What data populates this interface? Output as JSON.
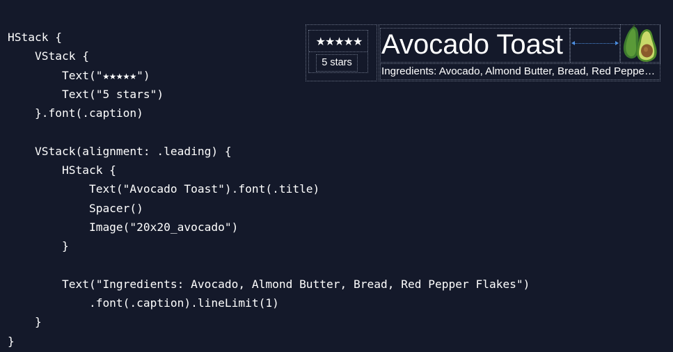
{
  "code": {
    "lines": [
      "HStack {",
      "    VStack {",
      "        Text(\"★★★★★\")",
      "        Text(\"5 stars\")",
      "    }.font(.caption)",
      "",
      "    VStack(alignment: .leading) {",
      "        HStack {",
      "            Text(\"Avocado Toast\").font(.title)",
      "            Spacer()",
      "            Image(\"20x20_avocado\")",
      "        }",
      "",
      "        Text(\"Ingredients: Avocado, Almond Butter, Bread, Red Pepper Flakes\")",
      "            .font(.caption).lineLimit(1)",
      "    }",
      "}"
    ]
  },
  "preview": {
    "stars": "★★★★★",
    "rating_label": "5 stars",
    "title": "Avocado Toast",
    "image_icon": "avocado-icon",
    "ingredients": "Ingredients: Avocado, Almond Butter, Bread, Red Pepper Flakes"
  },
  "colors": {
    "background": "#14192a",
    "text": "#ffffff",
    "frame_outline": "#6b7386",
    "spacer_indicator": "#4c8ee0"
  }
}
